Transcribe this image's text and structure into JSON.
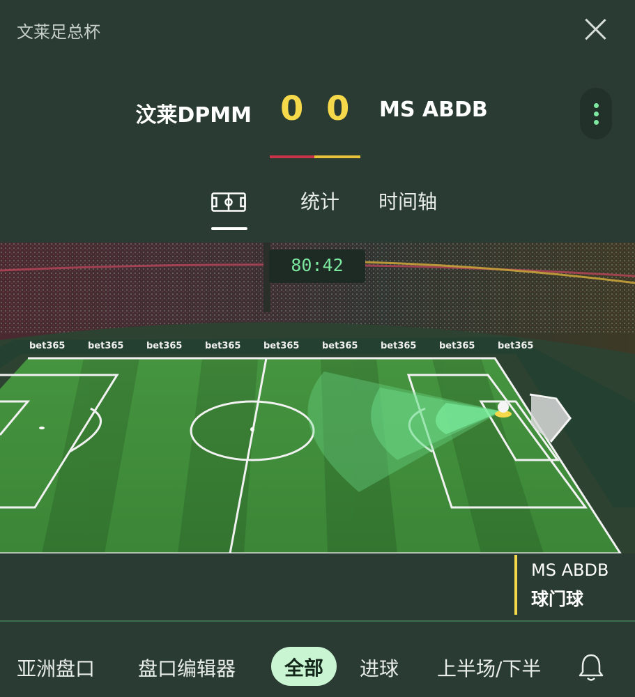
{
  "header": {
    "competition": "文莱足总杯",
    "home_team": "汶莱DPMM",
    "away_team": "MS ABDB",
    "home_score": "0",
    "away_score": "0",
    "home_color": "#c8334a",
    "away_color": "#e7c33a"
  },
  "tabs": {
    "pitch_icon": "pitch-icon",
    "stats": "统计",
    "timeline": "时间轴"
  },
  "match": {
    "clock": "80:42",
    "event_team": "MS ABDB",
    "event_type": "球门球",
    "sponsor": "bet365"
  },
  "bottom_nav": {
    "items": [
      "亚洲盘口",
      "盘口编辑器",
      "全部",
      "进球",
      "上半场/下半"
    ],
    "active": "全部"
  },
  "colors": {
    "accent": "#7de8a0",
    "score": "#f6d94a",
    "background": "#2a3b33",
    "pitch": "#3f8a3e"
  }
}
